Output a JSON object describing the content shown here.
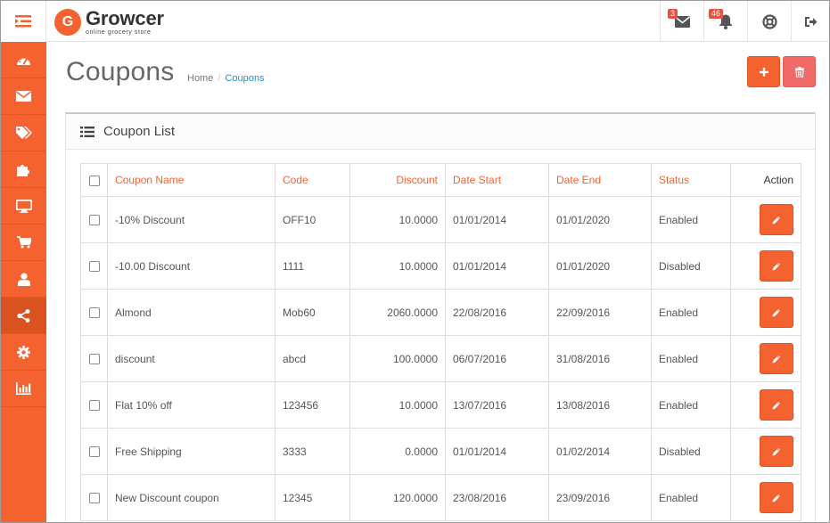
{
  "brand": {
    "name": "Growcer",
    "tagline": "online grocery store",
    "mark": "G"
  },
  "header": {
    "mail_count": "3",
    "alert_count": "46",
    "icons": [
      "menu-toggle-icon",
      "envelope-icon",
      "bell-icon",
      "life-ring-icon",
      "sign-out-icon"
    ]
  },
  "sidebar": {
    "items": [
      {
        "icon": "dashboard-icon"
      },
      {
        "icon": "envelope-icon"
      },
      {
        "icon": "tags-icon"
      },
      {
        "icon": "puzzle-icon"
      },
      {
        "icon": "monitor-icon"
      },
      {
        "icon": "cart-icon"
      },
      {
        "icon": "user-icon"
      },
      {
        "icon": "share-icon",
        "active": true
      },
      {
        "icon": "cog-icon"
      },
      {
        "icon": "bar-chart-icon"
      }
    ]
  },
  "page": {
    "title": "Coupons",
    "breadcrumb": [
      "Home",
      "Coupons"
    ]
  },
  "panel": {
    "title": "Coupon List"
  },
  "table": {
    "headers": {
      "name": "Coupon Name",
      "code": "Code",
      "discount": "Discount",
      "start": "Date Start",
      "end": "Date End",
      "status": "Status",
      "action": "Action"
    },
    "rows": [
      {
        "name": "-10% Discount",
        "code": "OFF10",
        "discount": "10.0000",
        "start": "01/01/2014",
        "end": "01/01/2020",
        "status": "Enabled"
      },
      {
        "name": "-10.00 Discount",
        "code": "1111",
        "discount": "10.0000",
        "start": "01/01/2014",
        "end": "01/01/2020",
        "status": "Disabled"
      },
      {
        "name": "Almond",
        "code": "Mob60",
        "discount": "2060.0000",
        "start": "22/08/2016",
        "end": "22/09/2016",
        "status": "Enabled"
      },
      {
        "name": "discount",
        "code": "abcd",
        "discount": "100.0000",
        "start": "06/07/2016",
        "end": "31/08/2016",
        "status": "Enabled"
      },
      {
        "name": "Flat 10% off",
        "code": "123456",
        "discount": "10.0000",
        "start": "13/07/2016",
        "end": "13/08/2016",
        "status": "Enabled"
      },
      {
        "name": "Free Shipping",
        "code": "3333",
        "discount": "0.0000",
        "start": "01/01/2014",
        "end": "01/02/2014",
        "status": "Disabled"
      },
      {
        "name": "New Discount coupon",
        "code": "12345",
        "discount": "120.0000",
        "start": "23/08/2016",
        "end": "23/09/2016",
        "status": "Enabled"
      }
    ]
  },
  "colors": {
    "accent": "#f4622f",
    "delete": "#f06b68",
    "link": "#1e91cf",
    "badge": "#e8513f"
  }
}
